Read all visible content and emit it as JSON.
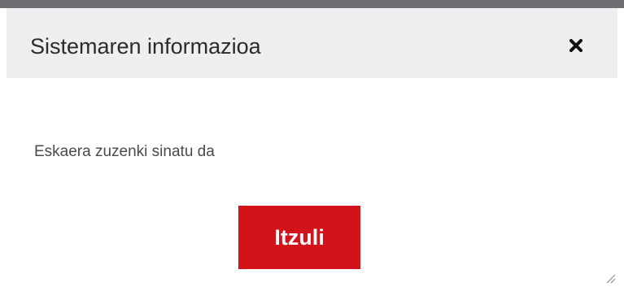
{
  "dialog": {
    "title": "Sistemaren informazioa",
    "close_icon": "close-icon",
    "message": "Eskaera zuzenki sinatu da",
    "back_button_label": "Itzuli",
    "resize_icon": "resize-handle-icon"
  },
  "colors": {
    "header_bg": "#eceeef",
    "accent": "#d2131a",
    "top_border": "#6f6f73"
  }
}
